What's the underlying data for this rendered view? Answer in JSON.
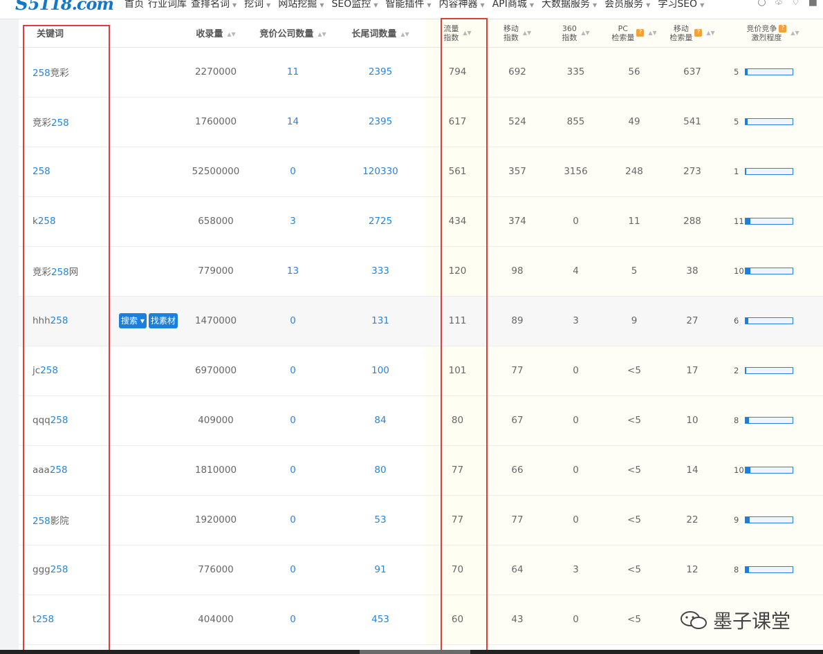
{
  "brand": {
    "logo_text": "5118.com",
    "logo_mark": "S"
  },
  "nav": {
    "items": [
      "首页",
      "行业词库",
      "查排名词",
      "挖词",
      "网站挖掘",
      "SEO监控",
      "智能插件",
      "内容神器",
      "API商城",
      "大数据服务",
      "会员服务",
      "学习SEO"
    ]
  },
  "table": {
    "headers": {
      "keyword": "关键词",
      "indexed": "收录量",
      "bid_companies": "竞价公司数量",
      "long_tail": "长尾词数量",
      "flow_index_1": "流量",
      "flow_index_2": "指数",
      "mobile_index_1": "移动",
      "mobile_index_2": "指数",
      "index360_1": "360",
      "index360_2": "指数",
      "pc_search_1": "PC",
      "pc_search_2": "检索量",
      "mobile_search_1": "移动",
      "mobile_search_2": "检索量",
      "bid_comp_1": "竞价竞争",
      "bid_comp_2": "激烈程度"
    },
    "help_icon": "?",
    "buttons": {
      "search": "搜索",
      "find_material": "找素材"
    },
    "rows": [
      {
        "kw_pre": "",
        "kw_hl": "258",
        "kw_post": "竞彩",
        "indexed": "2270000",
        "bid_companies": "11",
        "long_tail": "2395",
        "flow": "794",
        "mobile": "692",
        "i360": "335",
        "pc": "56",
        "msearch": "637",
        "bid": "5",
        "bid_level": 5
      },
      {
        "kw_pre": "竞彩",
        "kw_hl": "258",
        "kw_post": "",
        "indexed": "1760000",
        "bid_companies": "14",
        "long_tail": "2395",
        "flow": "617",
        "mobile": "524",
        "i360": "855",
        "pc": "49",
        "msearch": "541",
        "bid": "5",
        "bid_level": 5
      },
      {
        "kw_pre": "",
        "kw_hl": "258",
        "kw_post": "",
        "indexed": "52500000",
        "bid_companies": "0",
        "long_tail": "120330",
        "flow": "561",
        "mobile": "357",
        "i360": "3156",
        "pc": "248",
        "msearch": "273",
        "bid": "1",
        "bid_level": 1
      },
      {
        "kw_pre": "k",
        "kw_hl": "258",
        "kw_post": "",
        "indexed": "658000",
        "bid_companies": "3",
        "long_tail": "2725",
        "flow": "434",
        "mobile": "374",
        "i360": "0",
        "pc": "11",
        "msearch": "288",
        "bid": "11",
        "bid_level": 11
      },
      {
        "kw_pre": "竞彩",
        "kw_hl": "258",
        "kw_post": "网",
        "indexed": "779000",
        "bid_companies": "13",
        "long_tail": "333",
        "flow": "120",
        "mobile": "98",
        "i360": "4",
        "pc": "5",
        "msearch": "38",
        "bid": "10",
        "bid_level": 10
      },
      {
        "kw_pre": "hhh",
        "kw_hl": "258",
        "kw_post": "",
        "indexed": "1470000",
        "bid_companies": "0",
        "long_tail": "131",
        "flow": "111",
        "mobile": "89",
        "i360": "3",
        "pc": "9",
        "msearch": "27",
        "bid": "6",
        "bid_level": 6,
        "hovered": true
      },
      {
        "kw_pre": "jc",
        "kw_hl": "258",
        "kw_post": "",
        "indexed": "6970000",
        "bid_companies": "0",
        "long_tail": "100",
        "flow": "101",
        "mobile": "77",
        "i360": "0",
        "pc": "<5",
        "msearch": "17",
        "bid": "2",
        "bid_level": 2
      },
      {
        "kw_pre": "qqq",
        "kw_hl": "258",
        "kw_post": "",
        "indexed": "409000",
        "bid_companies": "0",
        "long_tail": "84",
        "flow": "80",
        "mobile": "67",
        "i360": "0",
        "pc": "<5",
        "msearch": "10",
        "bid": "8",
        "bid_level": 8
      },
      {
        "kw_pre": "aaa",
        "kw_hl": "258",
        "kw_post": "",
        "indexed": "1810000",
        "bid_companies": "0",
        "long_tail": "80",
        "flow": "77",
        "mobile": "66",
        "i360": "0",
        "pc": "<5",
        "msearch": "14",
        "bid": "10",
        "bid_level": 10
      },
      {
        "kw_pre": "",
        "kw_hl": "258",
        "kw_post": "影院",
        "indexed": "1920000",
        "bid_companies": "0",
        "long_tail": "53",
        "flow": "77",
        "mobile": "77",
        "i360": "0",
        "pc": "<5",
        "msearch": "22",
        "bid": "9",
        "bid_level": 9
      },
      {
        "kw_pre": "ggg",
        "kw_hl": "258",
        "kw_post": "",
        "indexed": "776000",
        "bid_companies": "0",
        "long_tail": "91",
        "flow": "70",
        "mobile": "64",
        "i360": "3",
        "pc": "<5",
        "msearch": "12",
        "bid": "8",
        "bid_level": 8
      },
      {
        "kw_pre": "t",
        "kw_hl": "258",
        "kw_post": "",
        "indexed": "404000",
        "bid_companies": "0",
        "long_tail": "453",
        "flow": "60",
        "mobile": "43",
        "i360": "0",
        "pc": "<5",
        "msearch": "",
        "bid": "",
        "bid_level": 0
      }
    ],
    "bid_max": 100
  },
  "watermark": {
    "text": "墨子课堂"
  },
  "colors": {
    "accent": "#1b7fde",
    "highlight_box": "#e03c3c"
  }
}
